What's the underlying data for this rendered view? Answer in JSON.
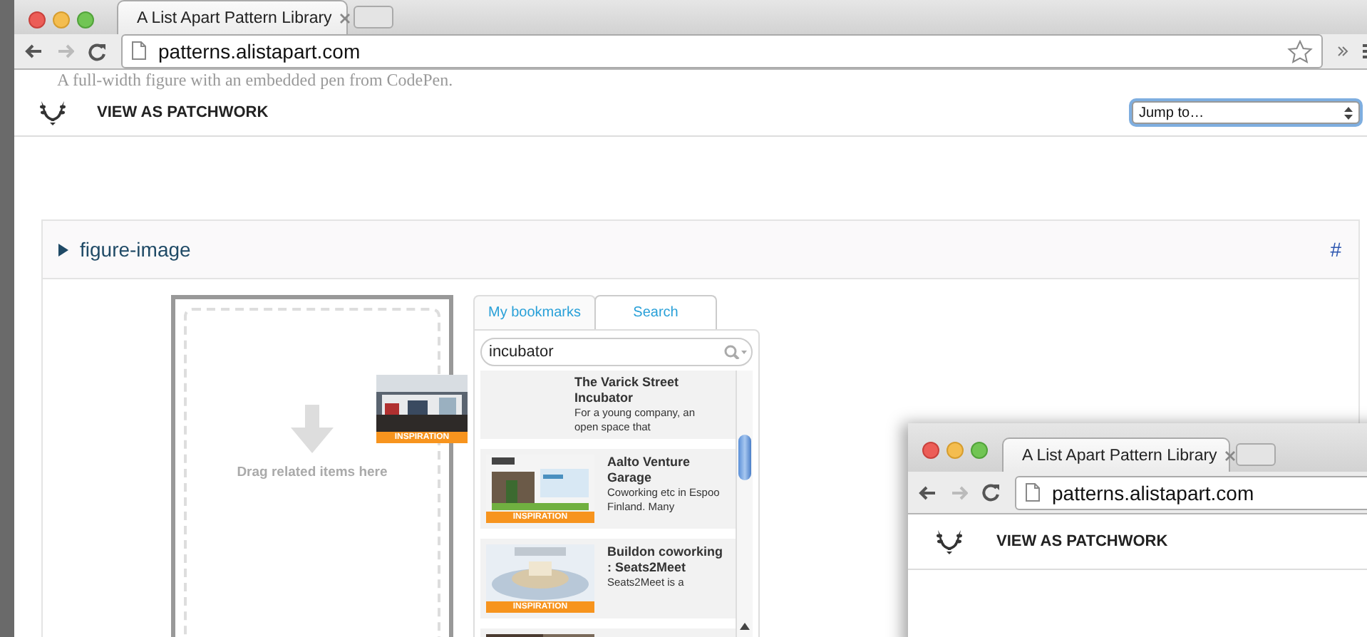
{
  "browser": {
    "tab_title": "A List Apart Pattern Library",
    "url": "patterns.alistapart.com"
  },
  "page": {
    "intro_text": "A full-width figure with an embedded pen from CodePen.",
    "nav_label": "VIEW AS PATCHWORK",
    "jump_select": {
      "value": "Jump to…",
      "focused": true
    }
  },
  "pattern": {
    "name": "figure-image",
    "expanded": false,
    "anchor": "#"
  },
  "dropzone": {
    "label": "Drag related items here"
  },
  "widget": {
    "tabs": [
      {
        "label": "My bookmarks",
        "selected": false
      },
      {
        "label": "Search",
        "selected": true
      }
    ],
    "search": {
      "value": "incubator"
    },
    "results": [
      {
        "title": "The Varick Street Incubator",
        "description": "For a young company, an open space that",
        "tag": "INSPIRATION",
        "dragging": true
      },
      {
        "title": "Aalto Venture Garage",
        "description": "Coworking etc in Espoo Finland. Many",
        "tag": "INSPIRATION",
        "dragging": false
      },
      {
        "title": "Buildon coworking : Seats2Meet",
        "description": "Seats2Meet is a",
        "tag": "INSPIRATION",
        "dragging": false
      }
    ]
  },
  "second_window": {
    "tab_title": "A List Apart Pattern Library",
    "url": "patterns.alistapart.com",
    "nav_label": "VIEW AS PATCHWORK"
  }
}
